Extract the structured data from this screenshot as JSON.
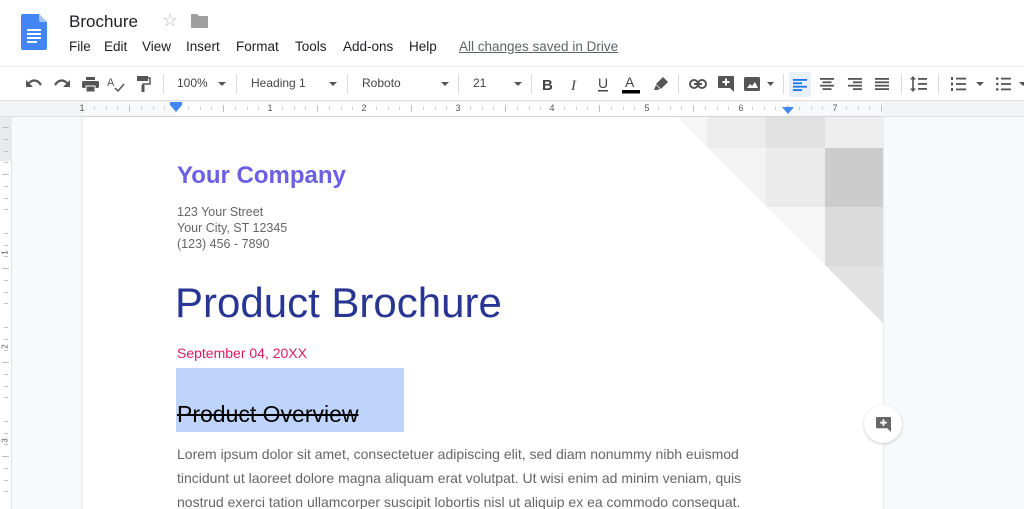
{
  "header": {
    "title": "Brochure",
    "star_icon": "star-outline-icon",
    "folder_icon": "folder-icon",
    "menu": [
      "File",
      "Edit",
      "View",
      "Insert",
      "Format",
      "Tools",
      "Add-ons",
      "Help"
    ],
    "save_status": "All changes saved in Drive"
  },
  "toolbar": {
    "zoom": "100%",
    "style": "Heading 1",
    "font": "Roboto",
    "font_size": "21",
    "text_color": "#000000",
    "active_alignment": "left"
  },
  "ruler": {
    "labels": [
      "1",
      "1",
      "2",
      "3",
      "4",
      "5",
      "6",
      "7"
    ],
    "vertical_labels": [
      "1",
      "2",
      "3"
    ]
  },
  "document": {
    "company": "Your Company",
    "address": [
      "123 Your Street",
      "Your City, ST 12345",
      "(123) 456 - 7890"
    ],
    "title": "Product Brochure",
    "date": "September 04, 20XX",
    "section_heading": "Product Overview",
    "body": [
      "Lorem ipsum dolor sit amet, consectetuer adipiscing elit, sed diam nonummy nibh euismod",
      "tincidunt ut laoreet dolore magna aliquam erat volutpat. Ut wisi enim ad minim veniam, quis",
      "nostrud exerci tation ullamcorper suscipit lobortis nisl ut aliquip ex ea commodo consequat."
    ],
    "colors": {
      "company": "#6b5fe3",
      "title": "#283593",
      "date": "#d81b60",
      "selection": "#bfd4fb"
    }
  }
}
